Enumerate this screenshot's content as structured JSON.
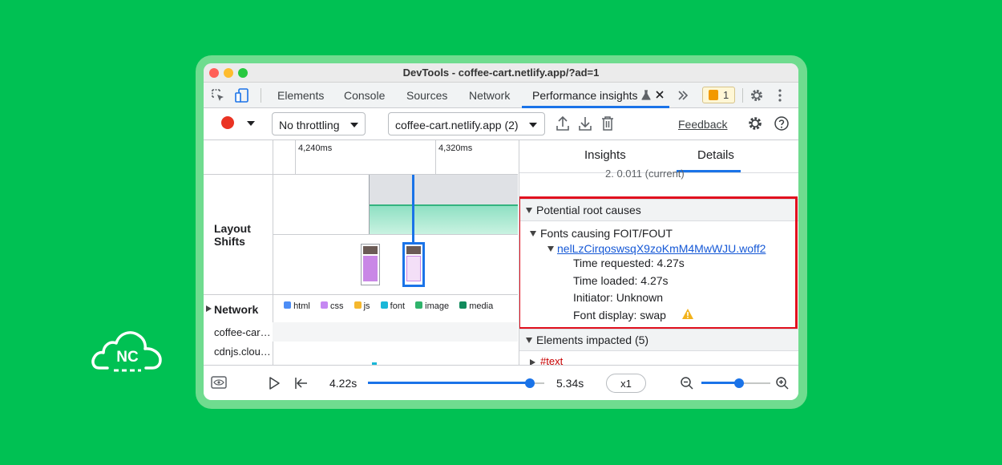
{
  "brand": {
    "logo_text": "NC"
  },
  "window": {
    "title": "DevTools - coffee-cart.netlify.app/?ad=1"
  },
  "tabs": [
    {
      "label": "Elements"
    },
    {
      "label": "Console"
    },
    {
      "label": "Sources"
    },
    {
      "label": "Network"
    },
    {
      "label": "Performance insights"
    }
  ],
  "issues": {
    "count": "1"
  },
  "toolbar": {
    "throttling": "No throttling",
    "recording": "coffee-cart.netlify.app (2)",
    "feedback": "Feedback"
  },
  "timeline": {
    "ticks": [
      "4,240ms",
      "4,320ms"
    ],
    "track_label": "Layout Shifts",
    "network_label": "Network",
    "legend": [
      {
        "label": "html",
        "color": "#4c8df6"
      },
      {
        "label": "css",
        "color": "#c588f2"
      },
      {
        "label": "js",
        "color": "#f5b82e"
      },
      {
        "label": "font",
        "color": "#1ab7d8"
      },
      {
        "label": "image",
        "color": "#2fb36b"
      },
      {
        "label": "media",
        "color": "#118a5c"
      }
    ],
    "rows": [
      "coffee-car…",
      "cdnjs.clou…"
    ]
  },
  "details": {
    "tabs": {
      "insights": "Insights",
      "details": "Details"
    },
    "partial_line": "2. 0.011 (current)",
    "root_causes": {
      "heading": "Potential root causes",
      "group": "Fonts causing FOIT/FOUT",
      "font_file": "nelLzCirqoswsqX9zoKmM4MwWJU.woff2",
      "time_requested": "Time requested: 4.27s",
      "time_loaded": "Time loaded: 4.27s",
      "initiator": "Initiator: Unknown",
      "font_display": "Font display: swap"
    },
    "elements_impacted": "Elements impacted (5)",
    "text_node": "#text"
  },
  "playback": {
    "start": "4.22s",
    "end": "5.34s",
    "speed": "x1",
    "progress": 0.92,
    "zoom": 0.55
  },
  "colors": {
    "accent": "#1a73e8",
    "highlight_box": "#e1101e",
    "warning": "#f2b21b"
  }
}
